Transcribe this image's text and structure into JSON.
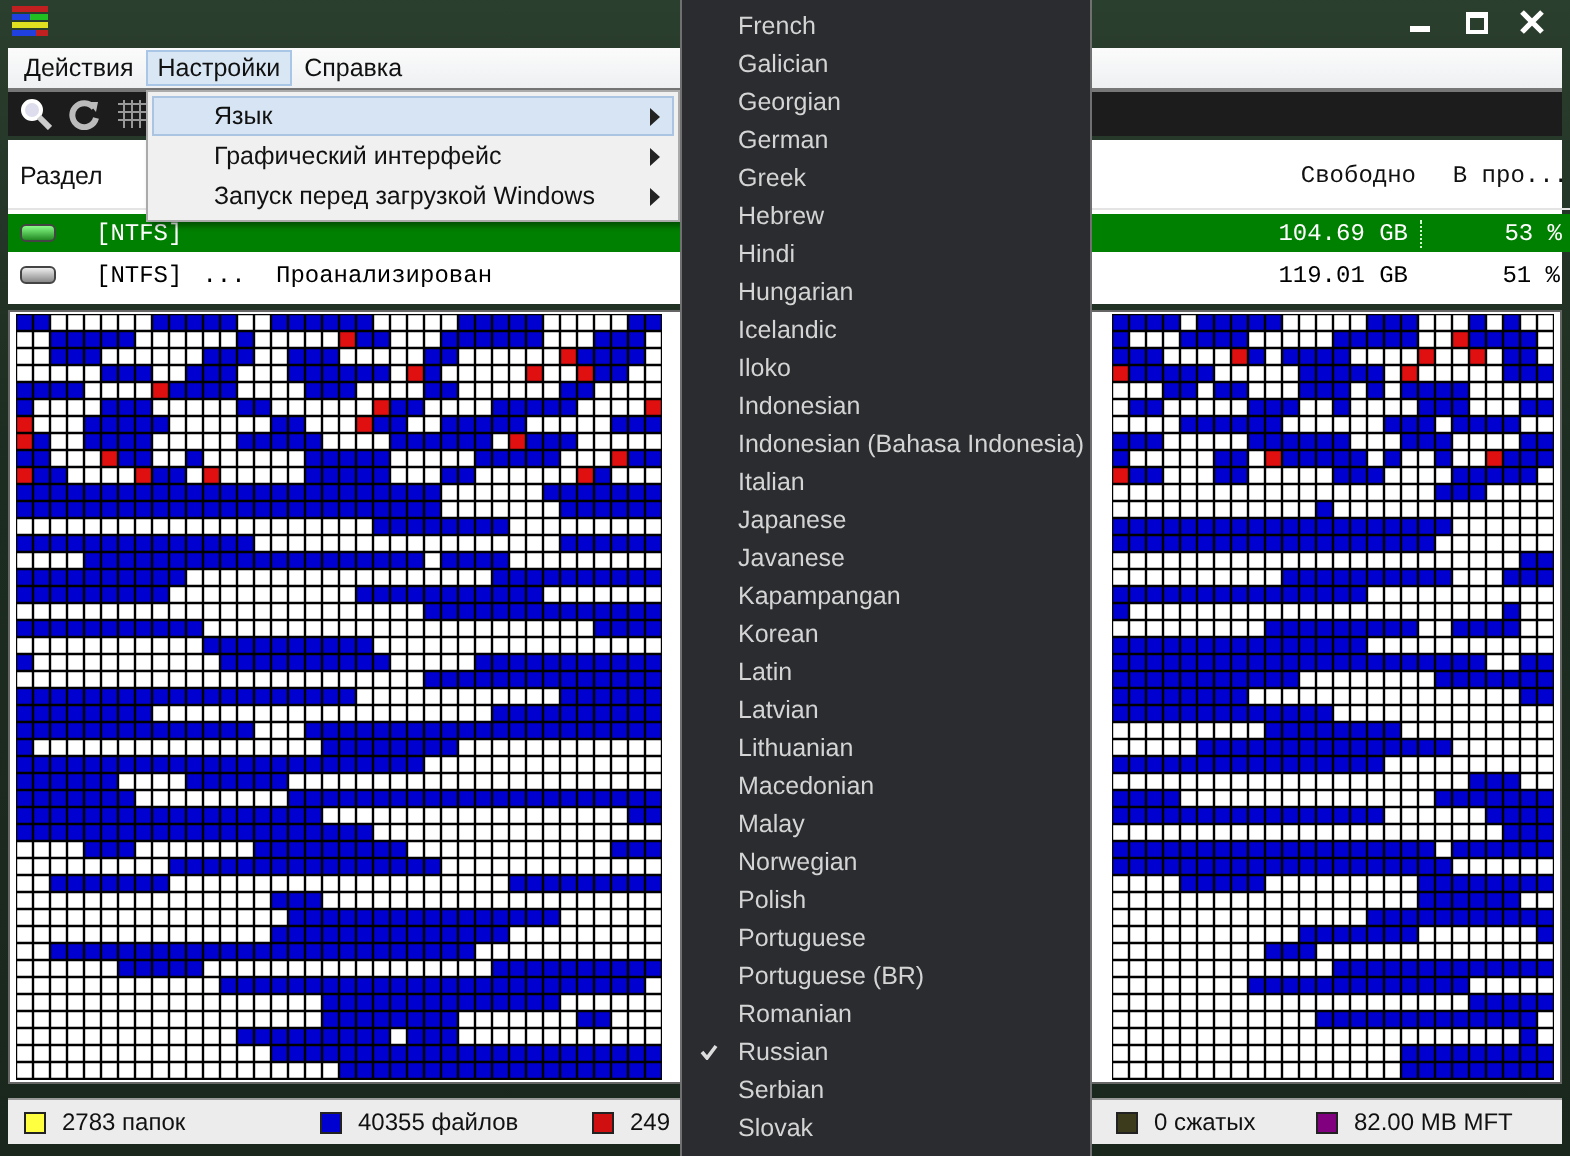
{
  "menu_bar": [
    {
      "label": "Действия",
      "selected": false
    },
    {
      "label": "Настройки",
      "selected": true
    },
    {
      "label": "Справка",
      "selected": false
    }
  ],
  "settings_menu": [
    {
      "label": "Язык",
      "selected": true,
      "has_submenu": true
    },
    {
      "label": "Графический интерфейс",
      "selected": false,
      "has_submenu": true
    },
    {
      "label": "Запуск перед загрузкой Windows",
      "selected": false,
      "has_submenu": true
    }
  ],
  "language_menu": [
    {
      "label": "French",
      "checked": false
    },
    {
      "label": "Galician",
      "checked": false
    },
    {
      "label": "Georgian",
      "checked": false
    },
    {
      "label": "German",
      "checked": false
    },
    {
      "label": "Greek",
      "checked": false
    },
    {
      "label": "Hebrew",
      "checked": false
    },
    {
      "label": "Hindi",
      "checked": false
    },
    {
      "label": "Hungarian",
      "checked": false
    },
    {
      "label": "Icelandic",
      "checked": false
    },
    {
      "label": "Iloko",
      "checked": false
    },
    {
      "label": "Indonesian",
      "checked": false
    },
    {
      "label": "Indonesian (Bahasa Indonesia)",
      "checked": false
    },
    {
      "label": "Italian",
      "checked": false
    },
    {
      "label": "Japanese",
      "checked": false
    },
    {
      "label": "Javanese",
      "checked": false
    },
    {
      "label": "Kapampangan",
      "checked": false
    },
    {
      "label": "Korean",
      "checked": false
    },
    {
      "label": "Latin",
      "checked": false
    },
    {
      "label": "Latvian",
      "checked": false
    },
    {
      "label": "Lithuanian",
      "checked": false
    },
    {
      "label": "Macedonian",
      "checked": false
    },
    {
      "label": "Malay",
      "checked": false
    },
    {
      "label": "Norwegian",
      "checked": false
    },
    {
      "label": "Polish",
      "checked": false
    },
    {
      "label": "Portuguese",
      "checked": false
    },
    {
      "label": "Portuguese (BR)",
      "checked": false
    },
    {
      "label": "Romanian",
      "checked": false
    },
    {
      "label": "Russian",
      "checked": true
    },
    {
      "label": "Serbian",
      "checked": false
    },
    {
      "label": "Slovak",
      "checked": false
    }
  ],
  "table": {
    "headers": {
      "partition": "Раздел",
      "free": "Свободно",
      "percent": "В про..."
    },
    "rows": [
      {
        "selected": true,
        "filesystem": "[NTFS]",
        "free": "104.69 GB",
        "percent": "53 %"
      },
      {
        "selected": false,
        "filesystem": "[NTFS]",
        "progress_dots": "...",
        "status": "Проанализирован",
        "free": "119.01 GB",
        "percent": "51 %"
      }
    ]
  },
  "status_bar": [
    {
      "label": "2783 папок",
      "color": "#ffff40"
    },
    {
      "label": "40355 файлов",
      "color": "#0000d0"
    },
    {
      "label": "249",
      "color": "#d01010"
    },
    {
      "label": "0 сжатых",
      "color": "#3c3c1c"
    },
    {
      "label": "82.00 MB MFT",
      "color": "#800080"
    }
  ]
}
